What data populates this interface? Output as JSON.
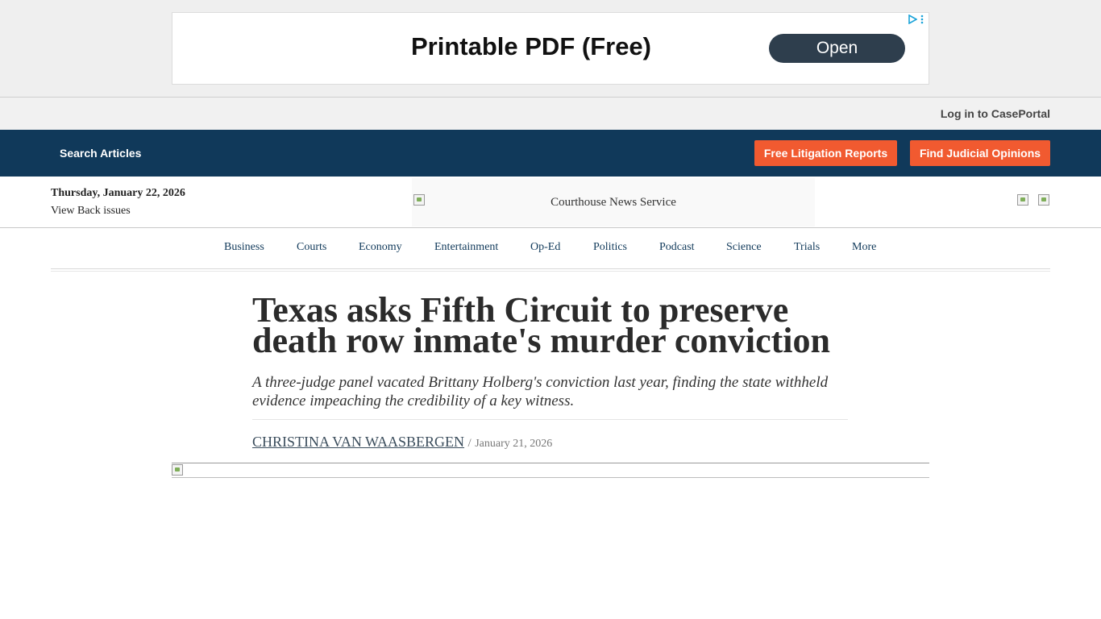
{
  "ad": {
    "headline": "Printable PDF (Free)",
    "button": "Open"
  },
  "login": {
    "label": "Log in to CasePortal"
  },
  "navbar": {
    "search": "Search Articles",
    "litigation_button": "Free Litigation Reports",
    "opinions_button": "Find Judicial Opinions",
    "accent": "#10395a",
    "button_color": "#f15a30"
  },
  "masthead": {
    "date": "Thursday, January 22, 2026",
    "back_issues": "View Back issues",
    "logo_alt": "Courthouse News Service"
  },
  "sections": [
    "Business",
    "Courts",
    "Economy",
    "Entertainment",
    "Op-Ed",
    "Politics",
    "Podcast",
    "Science",
    "Trials",
    "More"
  ],
  "article": {
    "headline": "Texas asks Fifth Circuit to preserve death row inmate's murder conviction",
    "subhead": "A three-judge panel vacated Brittany Holberg's conviction last year, finding the state withheld evidence impeaching the credibility of a key witness.",
    "author": "CHRISTINA VAN WAASBERGEN",
    "separator": "/",
    "date": "January 21, 2026"
  }
}
